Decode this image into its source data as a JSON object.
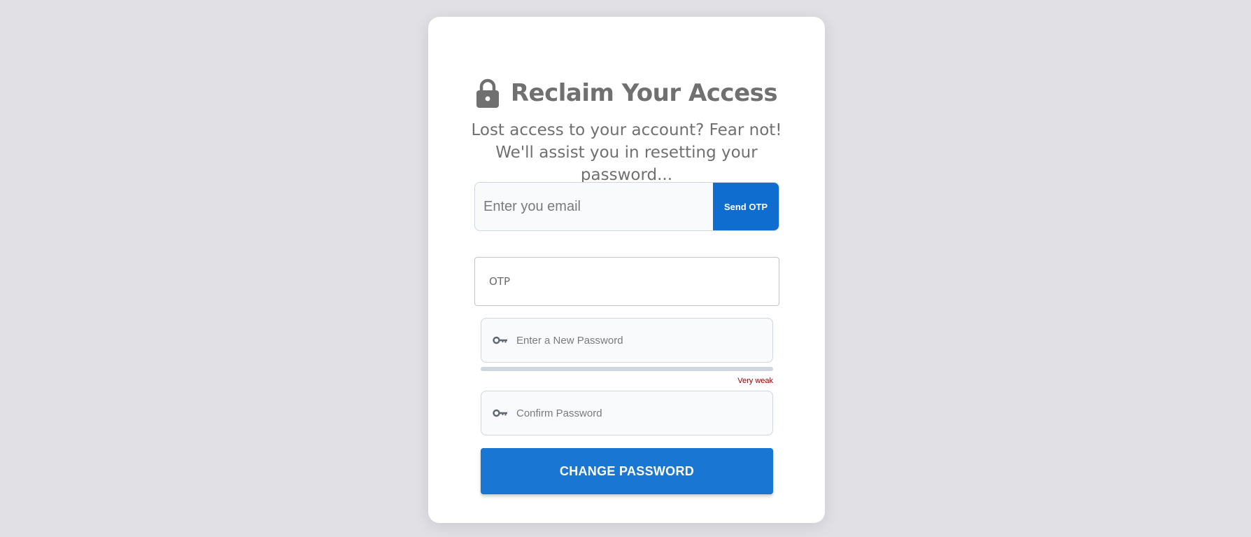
{
  "header": {
    "icon": "lock-icon",
    "title": "Reclaim Your Access",
    "subtitle": "Lost access to your account? Fear not! We'll assist you in resetting your password..."
  },
  "email": {
    "placeholder": "Enter you email",
    "value": "",
    "send_label": "Send OTP"
  },
  "otp": {
    "placeholder": "OTP",
    "value": ""
  },
  "new_password": {
    "icon": "key-icon",
    "placeholder": "Enter a New Password",
    "value": ""
  },
  "strength": {
    "level": 0,
    "label": "Very weak"
  },
  "confirm_password": {
    "icon": "key-icon",
    "placeholder": "Confirm Password",
    "value": ""
  },
  "submit": {
    "label": "CHANGE PASSWORD"
  },
  "colors": {
    "background": "#e0e0e5",
    "card": "#ffffff",
    "primary": "#1976d2",
    "send_button": "#0f6dd0",
    "title_text": "#707070",
    "strength_label": "#8b0000"
  }
}
